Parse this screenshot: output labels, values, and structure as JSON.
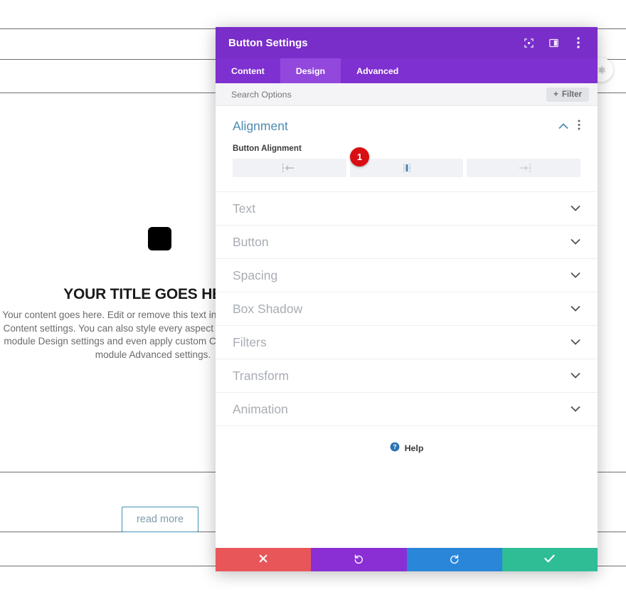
{
  "preview": {
    "title": "YOUR TITLE GOES HERE",
    "body": "Your content goes here. Edit or remove this text inline or in the module Content settings. You can also style every aspect of this content in the module Design settings and even apply custom CSS to this text in the module Advanced settings.",
    "read_more_label": "read more",
    "module_icon": "black-square-module-icon",
    "corner_icon": "settings-gear-icon"
  },
  "modal": {
    "title": "Button Settings",
    "header_icons": [
      {
        "name": "expand-fullscreen-icon"
      },
      {
        "name": "panel-layout-icon"
      },
      {
        "name": "more-vertical-icon"
      }
    ],
    "tabs": [
      {
        "label": "Content",
        "active": false
      },
      {
        "label": "Design",
        "active": true
      },
      {
        "label": "Advanced",
        "active": false
      }
    ],
    "search": {
      "placeholder": "Search Options",
      "value": ""
    },
    "filter_label": "Filter",
    "open_section": {
      "title": "Alignment",
      "field_label": "Button Alignment",
      "options": [
        {
          "name": "align-left",
          "active": false
        },
        {
          "name": "align-center",
          "active": true
        },
        {
          "name": "align-right",
          "active": false
        }
      ],
      "collapse_icon": "chevron-up-icon",
      "menu_icon": "more-vertical-icon"
    },
    "sections": [
      {
        "label": "Text"
      },
      {
        "label": "Button"
      },
      {
        "label": "Spacing"
      },
      {
        "label": "Box Shadow"
      },
      {
        "label": "Filters"
      },
      {
        "label": "Transform"
      },
      {
        "label": "Animation"
      }
    ],
    "help_label": "Help",
    "actions": [
      {
        "name": "cancel-button",
        "icon": "close-icon",
        "color": "#e9565a"
      },
      {
        "name": "undo-button",
        "icon": "undo-icon",
        "color": "#8a2fd4"
      },
      {
        "name": "redo-button",
        "icon": "redo-icon",
        "color": "#2a86d8"
      },
      {
        "name": "save-button",
        "icon": "check-icon",
        "color": "#2fbd95"
      }
    ]
  },
  "annotation": {
    "badge_number": "1"
  },
  "colors": {
    "header_purple": "#7a2ec9",
    "tabbar_purple": "#7f30d0",
    "active_tab_purple": "#9348dd",
    "section_title_blue": "#4d8bb0",
    "badge_red": "#d80e13"
  }
}
